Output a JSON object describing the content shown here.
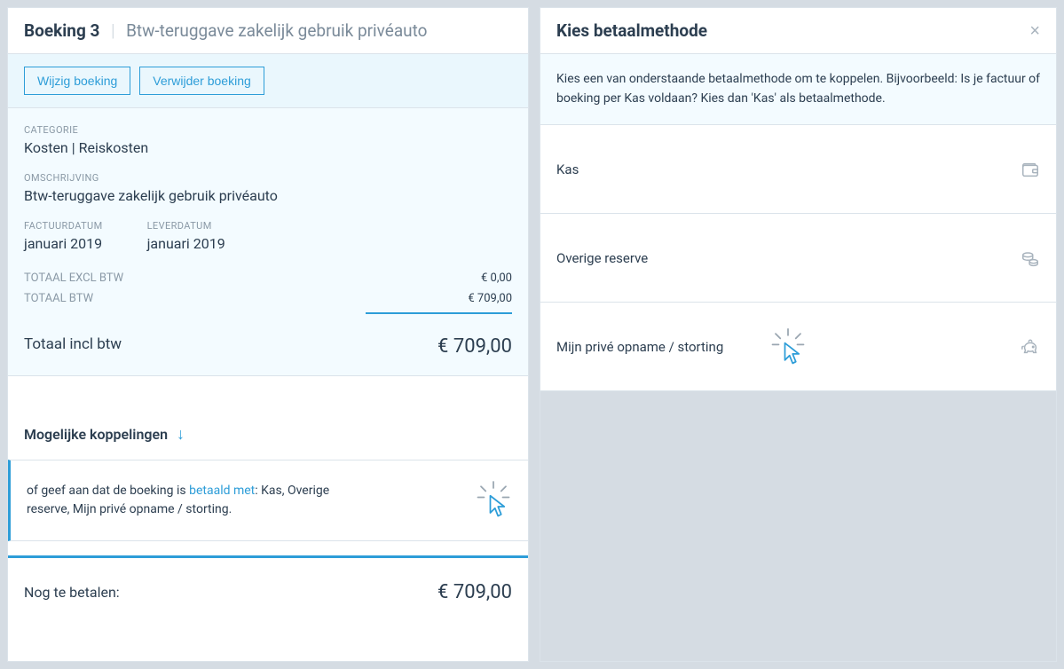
{
  "left": {
    "title_prefix": "Boeking 3",
    "title_sub": "Btw-teruggave zakelijk gebruik privéauto",
    "actions": {
      "edit": "Wijzig boeking",
      "delete": "Verwijder boeking"
    },
    "category_label": "CATEGORIE",
    "category_value": "Kosten | Reiskosten",
    "description_label": "OMSCHRIJVING",
    "description_value": "Btw-teruggave zakelijk gebruik privéauto",
    "invoice_date_label": "FACTUURDATUM",
    "invoice_date_value": "januari 2019",
    "delivery_date_label": "LEVERDATUM",
    "delivery_date_value": "januari 2019",
    "total_excl_label": "TOTAAL EXCL BTW",
    "total_excl_value": "€ 0,00",
    "total_btw_label": "TOTAAL BTW",
    "total_btw_value": "€ 709,00",
    "total_incl_label": "Totaal incl btw",
    "total_incl_value": "€ 709,00",
    "koppel_heading": "Mogelijke koppelingen",
    "koppel_text_before": "of geef aan dat de boeking is ",
    "koppel_link": "betaald met",
    "koppel_text_after": ": Kas, Overige reserve, Mijn privé opname / storting.",
    "nog_label": "Nog te betalen:",
    "nog_value": "€ 709,00"
  },
  "right": {
    "title": "Kies betaalmethode",
    "info": "Kies een van onderstaande betaalmethode om te koppelen. Bijvoorbeeld: Is je factuur of boeking per Kas voldaan? Kies dan 'Kas' als betaalmethode.",
    "methods": {
      "kas": "Kas",
      "overige": "Overige reserve",
      "prive": "Mijn privé opname / storting"
    }
  }
}
